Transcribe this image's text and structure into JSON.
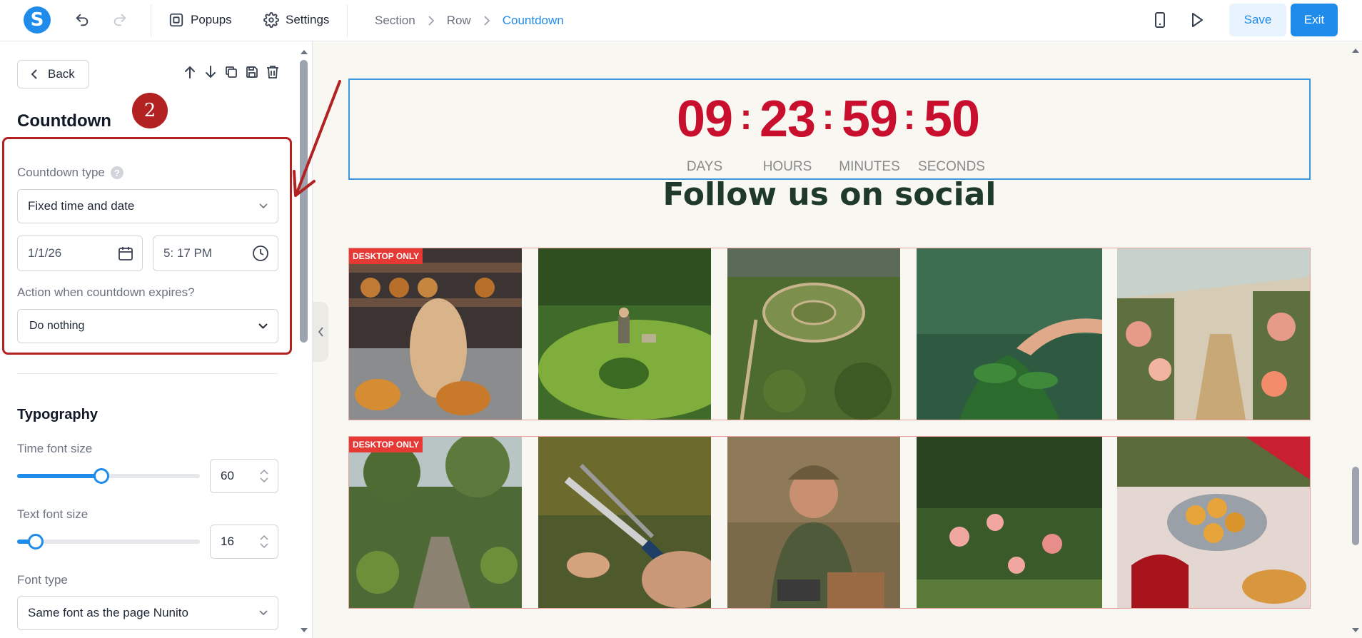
{
  "topbar": {
    "logo_letter": "S",
    "popups_label": "Popups",
    "settings_label": "Settings",
    "breadcrumbs": [
      "Section",
      "Row",
      "Countdown"
    ],
    "save_label": "Save",
    "exit_label": "Exit"
  },
  "panel": {
    "back_label": "Back",
    "title": "Countdown",
    "step_badge": "2",
    "countdown_type_label": "Countdown type",
    "countdown_type_value": "Fixed time and date",
    "date_value": "1/1/26",
    "time_value": "5: 17 PM",
    "expire_label": "Action when countdown expires?",
    "expire_value": "Do nothing",
    "typography_heading": "Typography",
    "time_font_size_label": "Time font size",
    "time_font_size_value": "60",
    "time_font_size_fraction": 0.46,
    "text_font_size_label": "Text font size",
    "text_font_size_value": "16",
    "text_font_size_fraction": 0.1,
    "font_type_label": "Font type",
    "font_type_value": "Same font as the page Nunito"
  },
  "canvas": {
    "countdown": {
      "days": "09",
      "hours": "23",
      "minutes": "59",
      "seconds": "50",
      "days_label": "DAYS",
      "hours_label": "HOURS",
      "minutes_label": "MINUTES",
      "seconds_label": "SECONDS",
      "digit_color": "#c8102e"
    },
    "social_title": "Follow us on social",
    "desktop_only_badge": "DESKTOP ONLY",
    "gallery_rows": [
      [
        "bakery",
        "lawn-mowing",
        "aerial-garden",
        "hand-seedlings",
        "greenhouse-roses"
      ],
      [
        "garden-path",
        "pruning-shears",
        "smiling-gardener",
        "rose-bushes",
        "picnic-muffins"
      ]
    ]
  },
  "colors": {
    "accent": "#1f8ceb",
    "annotation": "#b22222"
  }
}
